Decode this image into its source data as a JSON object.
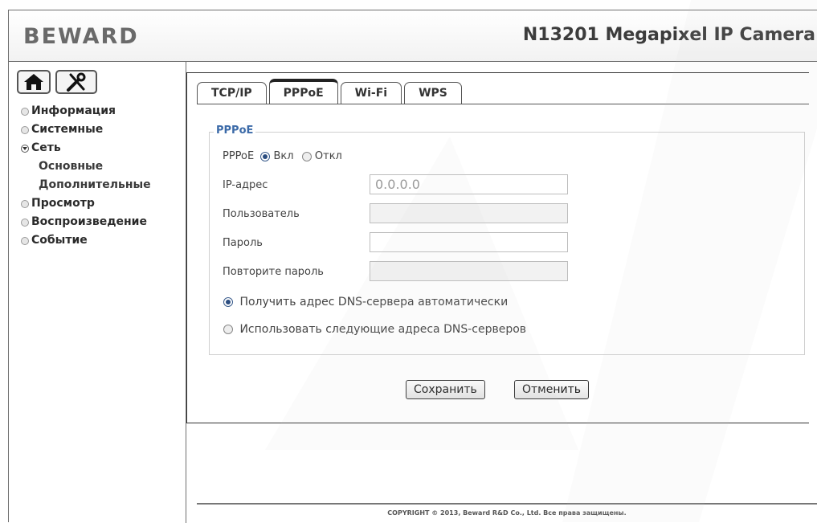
{
  "header": {
    "logo": "BEWARD",
    "product_title": "N13201 Megapixel IP Camera"
  },
  "toolbar": {
    "home_icon": "home-icon",
    "settings_icon": "tools-icon"
  },
  "sidebar": {
    "items": [
      {
        "label": "Информация"
      },
      {
        "label": "Системные"
      },
      {
        "label": "Сеть"
      },
      {
        "label": "Основные"
      },
      {
        "label": "Дополнительные"
      },
      {
        "label": "Просмотр"
      },
      {
        "label": "Воспроизведение"
      },
      {
        "label": "Событие"
      }
    ]
  },
  "tabs": [
    {
      "label": "TCP/IP"
    },
    {
      "label": "PPPoE"
    },
    {
      "label": "Wi-Fi"
    },
    {
      "label": "WPS"
    }
  ],
  "form": {
    "legend": "PPPoE",
    "pppoe_label": "PPPoE",
    "on_label": "Вкл",
    "off_label": "Откл",
    "ip_label": "IP-адрес",
    "ip_value": "0.0.0.0",
    "user_label": "Пользователь",
    "password_label": "Пароль",
    "repeat_label": "Повторите пароль",
    "dns_auto_label": "Получить адрес DNS-сервера автоматически",
    "dns_manual_label": "Использовать следующие адреса DNS-серверов",
    "save_label": "Сохранить",
    "cancel_label": "Отменить"
  },
  "footer": {
    "copyright": "COPYRIGHT © 2013, Beward R&D Co., Ltd. Все права защищены."
  },
  "colors": {
    "legend": "#3b6aa8",
    "border": "#6e6e6e"
  }
}
